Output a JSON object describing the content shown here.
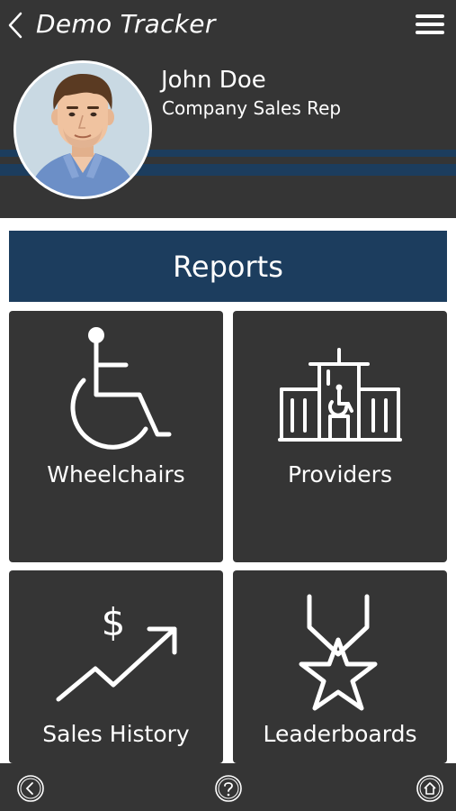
{
  "header": {
    "title": "Demo Tracker",
    "back_icon": "chevron-left-icon",
    "menu_icon": "hamburger-menu-icon"
  },
  "profile": {
    "name": "John Doe",
    "role": "Company Sales Rep"
  },
  "section": {
    "title": "Reports"
  },
  "tiles": [
    {
      "label": "Wheelchairs",
      "icon": "wheelchair-icon"
    },
    {
      "label": "Providers",
      "icon": "hospital-building-icon"
    },
    {
      "label": "Sales History",
      "icon": "sales-trend-icon"
    },
    {
      "label": "Leaderboards",
      "icon": "medal-star-icon"
    }
  ],
  "bottom_nav": [
    {
      "icon": "back-circle-icon"
    },
    {
      "icon": "help-circle-icon"
    },
    {
      "icon": "home-circle-icon"
    }
  ],
  "colors": {
    "header_bg": "#353535",
    "accent_navy": "#1c3d5e",
    "tile_bg": "#353535",
    "text": "#ffffff"
  }
}
